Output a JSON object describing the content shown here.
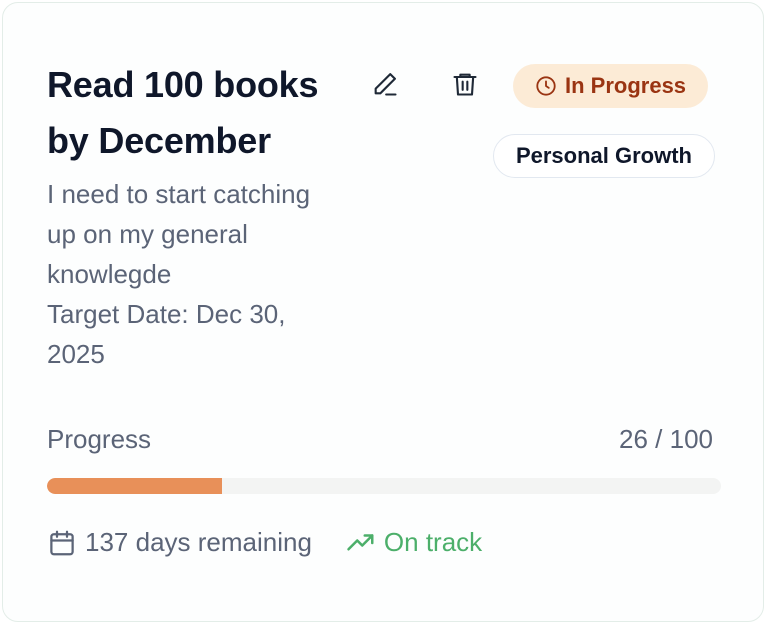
{
  "goal": {
    "title": "Read 100 books by December",
    "description_lines": [
      "I need to start catching",
      "up on my general",
      "knowlegde"
    ],
    "target_date_lines": [
      "Target Date: Dec 30,",
      "2025"
    ],
    "status": "In Progress",
    "category": "Personal Growth",
    "progress_label": "Progress",
    "progress_text": "26 / 100",
    "progress_fraction": 0.26,
    "days_remaining": "137 days remaining",
    "track_status": "On track"
  },
  "colors": {
    "accent": "#e89059",
    "status_bg": "#fcebd6",
    "status_text": "#9a3412",
    "on_track": "#4caf6a"
  },
  "icons": {
    "edit": "pencil-icon",
    "delete": "trash-icon",
    "status": "clock-icon",
    "date": "calendar-icon",
    "trend": "trending-up-icon"
  }
}
